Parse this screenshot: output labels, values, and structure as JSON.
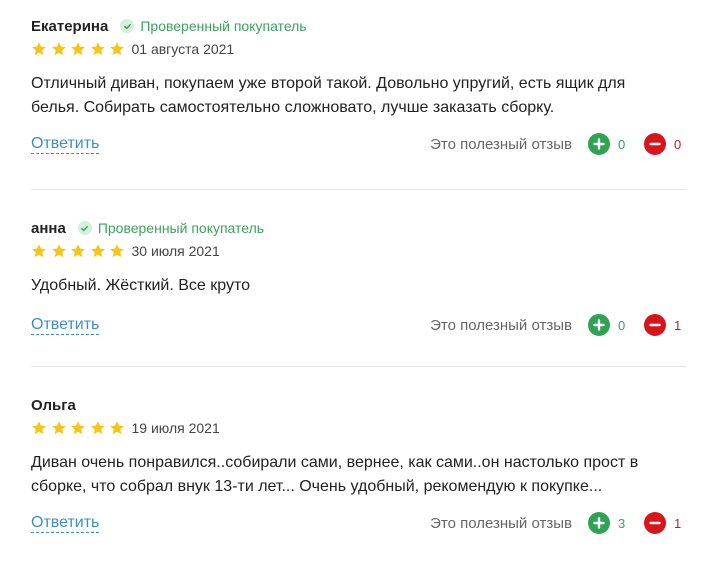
{
  "colors": {
    "accent_link": "#3b8fc6",
    "verified": "#3aa35c",
    "star": "#f5c518",
    "vote_plus": "#2fa353",
    "vote_minus": "#d9151b"
  },
  "reviews": [
    {
      "author": "Екатерина",
      "verified_label": "Проверенный покупатель",
      "rating": 5,
      "date": "01 августа 2021",
      "text": "Отличный диван, покупаем уже второй такой. Довольно упругий, есть ящик для белья. Собирать самостоятельно сложновато, лучше заказать сборку.",
      "reply_label": "Ответить",
      "useful_label": "Это полезный отзыв",
      "likes": "0",
      "dislikes": "0"
    },
    {
      "author": "анна",
      "verified_label": "Проверенный покупатель",
      "rating": 5,
      "date": "30 июля 2021",
      "text": "Удобный. Жёсткий. Все круто",
      "reply_label": "Ответить",
      "useful_label": "Это полезный отзыв",
      "likes": "0",
      "dislikes": "1"
    },
    {
      "author": "Ольга",
      "verified_label": "",
      "rating": 5,
      "date": "19 июля 2021",
      "text": "Диван очень понравился..собирали сами, вернее, как сами..он настолько прост в сборке, что собрал внук 13-ти лет... Очень удобный, рекомендую к покупке...",
      "reply_label": "Ответить",
      "useful_label": "Это полезный отзыв",
      "likes": "3",
      "dislikes": "1"
    }
  ]
}
